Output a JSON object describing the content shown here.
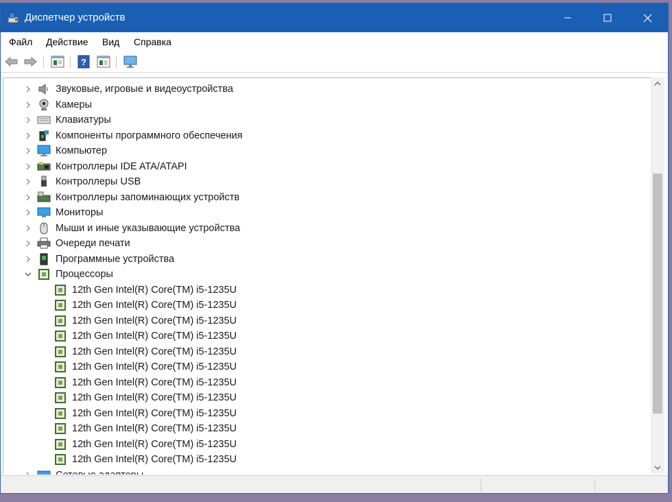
{
  "window": {
    "title": "Диспетчер устройств",
    "titlebar_color": "#1a5fb4"
  },
  "menu": [
    "Файл",
    "Действие",
    "Вид",
    "Справка"
  ],
  "toolbar": {
    "icons": [
      "back-arrow-icon",
      "forward-arrow-icon",
      "properties-icon",
      "help-icon",
      "show-hidden-icon",
      "monitor-scan-icon"
    ]
  },
  "tree": {
    "categories": [
      {
        "label": "Звуковые, игровые и видеоустройства",
        "icon": "speaker-icon",
        "expanded": false
      },
      {
        "label": "Камеры",
        "icon": "webcam-icon",
        "expanded": false
      },
      {
        "label": "Клавиатуры",
        "icon": "keyboard-icon",
        "expanded": false
      },
      {
        "label": "Компоненты программного обеспечения",
        "icon": "software-component-icon",
        "expanded": false
      },
      {
        "label": "Компьютер",
        "icon": "computer-icon",
        "expanded": false
      },
      {
        "label": "Контроллеры IDE ATA/ATAPI",
        "icon": "ide-controller-icon",
        "expanded": false
      },
      {
        "label": "Контроллеры USB",
        "icon": "usb-icon",
        "expanded": false
      },
      {
        "label": "Контроллеры запоминающих устройств",
        "icon": "storage-controller-icon",
        "expanded": false
      },
      {
        "label": "Мониторы",
        "icon": "monitor-icon",
        "expanded": false
      },
      {
        "label": "Мыши и иные указывающие устройства",
        "icon": "mouse-icon",
        "expanded": false
      },
      {
        "label": "Очереди печати",
        "icon": "printer-icon",
        "expanded": false
      },
      {
        "label": "Программные устройства",
        "icon": "software-device-icon",
        "expanded": false
      },
      {
        "label": "Процессоры",
        "icon": "processor-icon",
        "expanded": true
      }
    ],
    "processors": [
      "12th Gen Intel(R) Core(TM) i5-1235U",
      "12th Gen Intel(R) Core(TM) i5-1235U",
      "12th Gen Intel(R) Core(TM) i5-1235U",
      "12th Gen Intel(R) Core(TM) i5-1235U",
      "12th Gen Intel(R) Core(TM) i5-1235U",
      "12th Gen Intel(R) Core(TM) i5-1235U",
      "12th Gen Intel(R) Core(TM) i5-1235U",
      "12th Gen Intel(R) Core(TM) i5-1235U",
      "12th Gen Intel(R) Core(TM) i5-1235U",
      "12th Gen Intel(R) Core(TM) i5-1235U",
      "12th Gen Intel(R) Core(TM) i5-1235U",
      "12th Gen Intel(R) Core(TM) i5-1235U"
    ],
    "last_partial": {
      "label": "Сетевые адаптеры",
      "icon": "network-adapter-icon"
    }
  }
}
